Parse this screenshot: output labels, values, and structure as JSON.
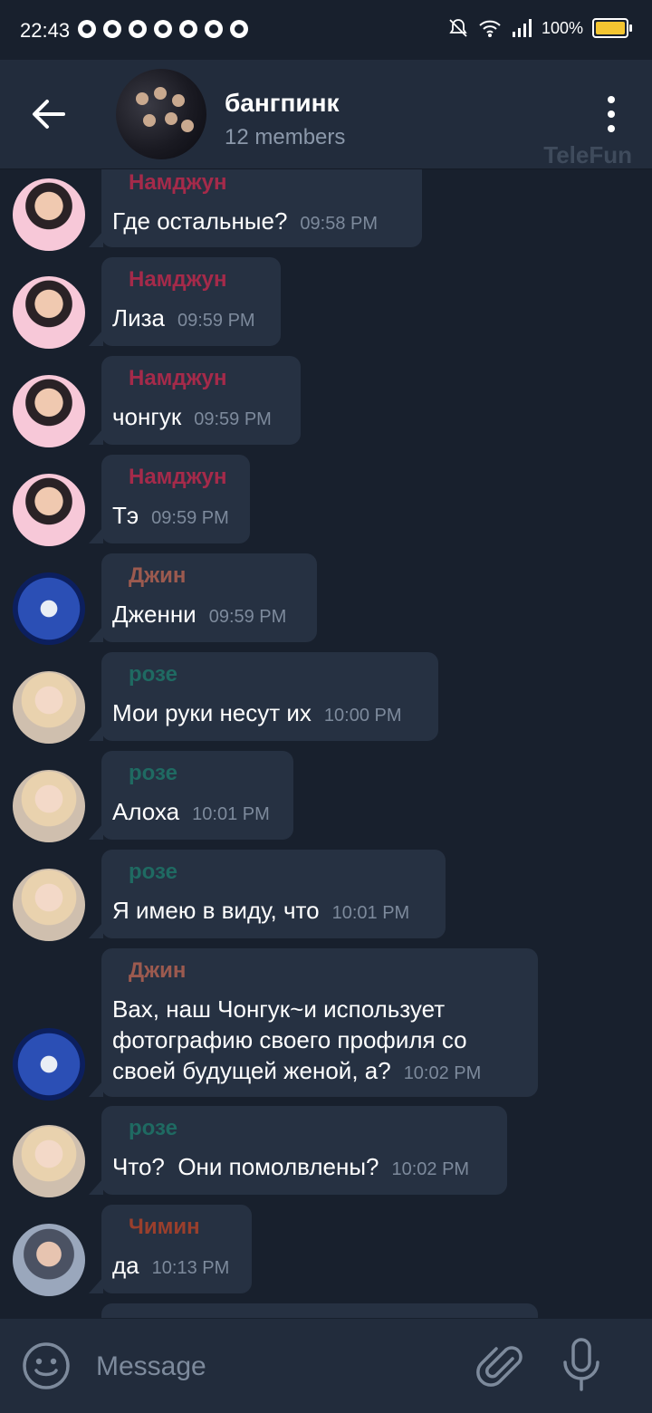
{
  "status_bar": {
    "time": "22:43",
    "battery_percent": "100%",
    "battery_level": 1.0,
    "notification_icons": [
      "messenger-icon",
      "chrome-icon",
      "chrome-icon",
      "chrome-icon",
      "chrome-icon",
      "chrome-icon",
      "chrome-icon"
    ]
  },
  "header": {
    "title": "бангпинк",
    "subtitle": "12 members",
    "watermark": "TeleFun"
  },
  "colors": {
    "background": "#18202d",
    "header": "#222c3c",
    "bubble": "#263142",
    "namjoon": "#a52a4a",
    "jin": "#9c5a4f",
    "rose": "#1f6a62",
    "jimin": "#9a3f2c"
  },
  "messages": [
    {
      "sender": "Намджун",
      "text": "Где остальные?",
      "time": "09:58 PM"
    },
    {
      "sender": "Намджун",
      "text": "Лиза",
      "time": "09:59 PM"
    },
    {
      "sender": "Намджун",
      "text": "чонгук",
      "time": "09:59 PM"
    },
    {
      "sender": "Намджун",
      "text": "Тэ",
      "time": "09:59 PM"
    },
    {
      "sender": "Джин",
      "text": "Дженни",
      "time": "09:59 PM"
    },
    {
      "sender": "розе",
      "text": "Мои руки несут их",
      "time": "10:00 PM"
    },
    {
      "sender": "розе",
      "text": "Алоха",
      "time": "10:01 PM"
    },
    {
      "sender": "розе",
      "text": "Я имею в виду, что",
      "time": "10:01 PM"
    },
    {
      "sender": "Джин",
      "text": "Вах, наш Чонгук~и использует фотографию своего профиля со своей будущей женой, а?",
      "time": "10:02 PM"
    },
    {
      "sender": "розе",
      "text": "Что?  Они помолвлены?",
      "time": "10:02 PM"
    },
    {
      "sender": "Чимин",
      "text": "да",
      "time": "10:13 PM"
    }
  ],
  "composer": {
    "placeholder": "Message"
  }
}
